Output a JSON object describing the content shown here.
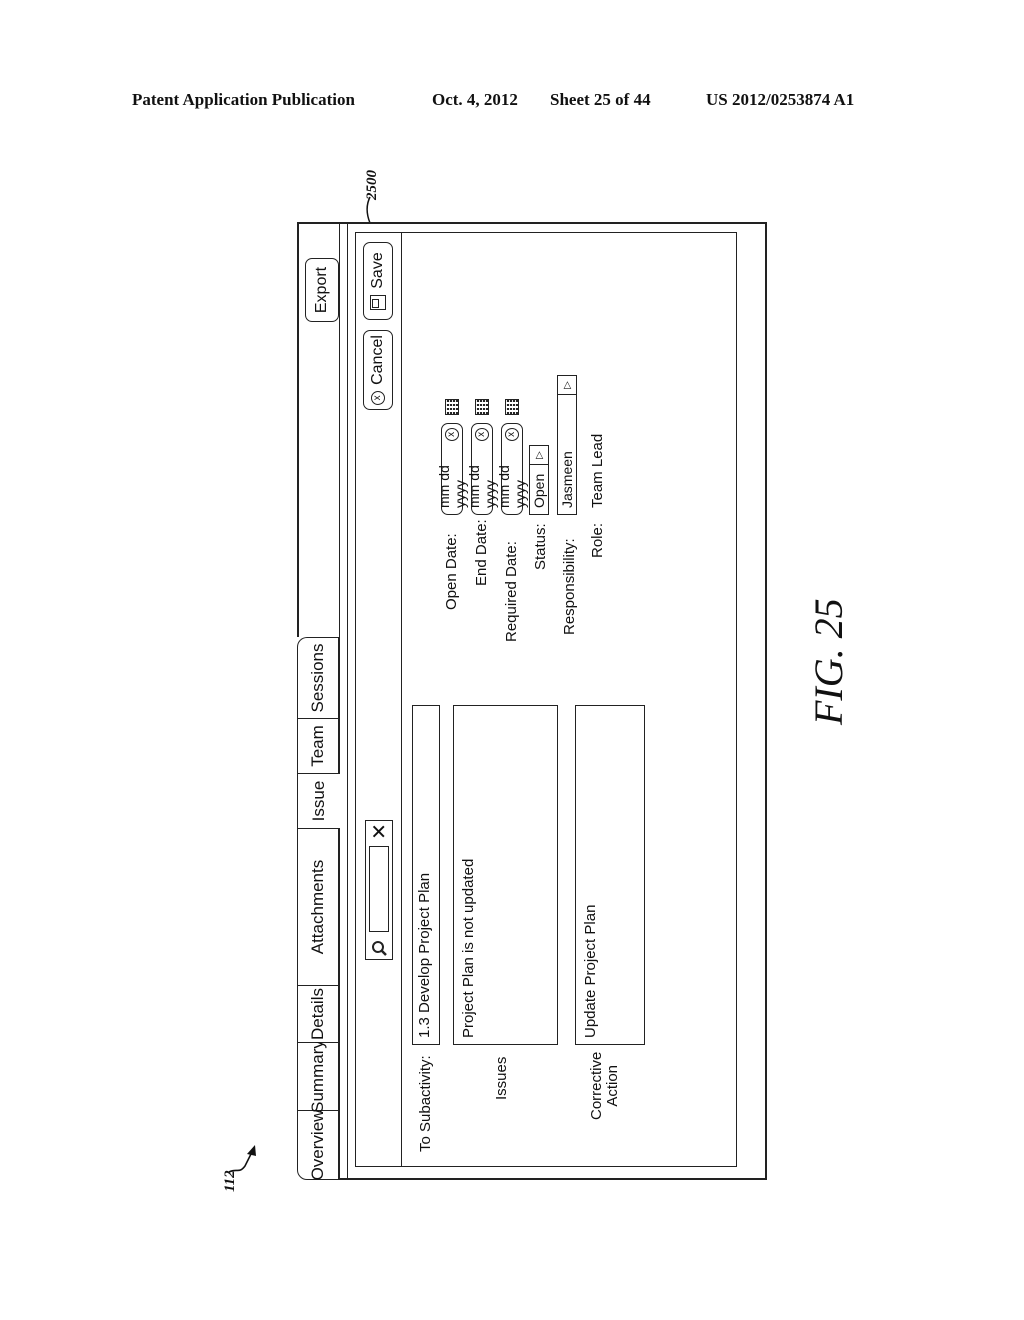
{
  "header": {
    "publication": "Patent Application Publication",
    "date": "Oct. 4, 2012",
    "sheet": "Sheet 25 of 44",
    "patent_number": "US 2012/0253874 A1"
  },
  "references": {
    "window_ref": "2500",
    "pointer_ref": "112"
  },
  "figure_label": "FIG. 25",
  "window": {
    "tabs": [
      {
        "label": "Overview",
        "active": false
      },
      {
        "label": "Summary",
        "active": false
      },
      {
        "label": "Details",
        "active": false
      },
      {
        "label": "Attachments",
        "active": false
      },
      {
        "label": "Issue",
        "active": true
      },
      {
        "label": "Team",
        "active": false
      },
      {
        "label": "Sessions",
        "active": false
      }
    ],
    "export_label": "Export",
    "toolbar": {
      "search_placeholder": "",
      "search_icon": "search-icon",
      "clear_icon": "close-icon",
      "cancel_label": "Cancel",
      "cancel_icon": "circle-x-icon",
      "save_label": "Save",
      "save_icon": "save-icon"
    },
    "form": {
      "subactivity_label": "To Subactivity:",
      "subactivity_value": "1.3 Develop Project Plan",
      "issues_label": "Issues",
      "issues_value": "Project Plan is not updated",
      "corrective_label_line1": "Corrective",
      "corrective_label_line2": "Action",
      "corrective_value": "Update Project Plan",
      "open_date_label": "Open Date:",
      "open_date_value": "mm dd yyyy",
      "end_date_label": "End Date:",
      "end_date_value": "mm dd yyyy",
      "required_date_label": "Required Date:",
      "required_date_value": "mm dd yyyy",
      "status_label": "Status:",
      "status_value": "Open",
      "responsibility_label": "Responsibility:",
      "responsibility_value": "Jasmeen",
      "role_label": "Role:",
      "role_value": "Team Lead"
    }
  }
}
